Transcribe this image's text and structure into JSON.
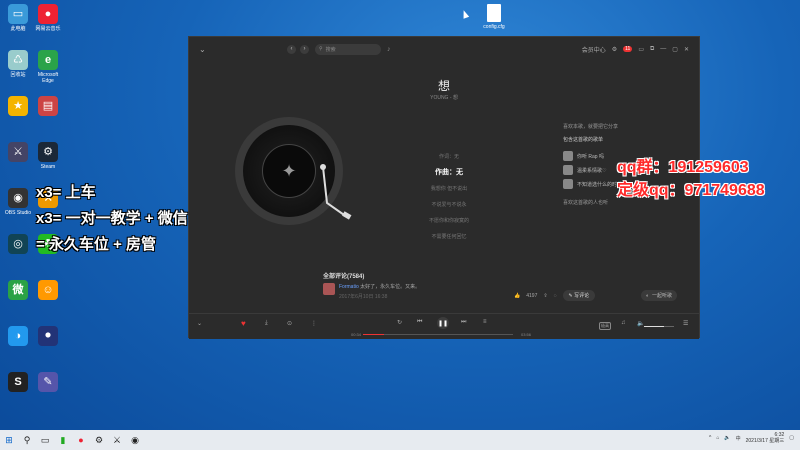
{
  "desktop": {
    "icons": [
      {
        "label": "此电脑",
        "glyph": "▭",
        "color": "#3a9ad9"
      },
      {
        "label": "网易云音乐",
        "glyph": "●",
        "color": "#e23"
      },
      {
        "label": "回收站",
        "glyph": "♺",
        "color": "#9cc"
      },
      {
        "label": "Microsoft Edge",
        "glyph": "e",
        "color": "#2aa34a"
      },
      {
        "label": "",
        "glyph": "★",
        "color": "#f4b400"
      },
      {
        "label": "",
        "glyph": "▤",
        "color": "#c44"
      },
      {
        "label": "",
        "glyph": "⚔",
        "color": "#446"
      },
      {
        "label": "Steam",
        "glyph": "⚙",
        "color": "#1b2838"
      },
      {
        "label": "OBS Studio",
        "glyph": "◉",
        "color": "#333"
      },
      {
        "label": "",
        "glyph": "⚒",
        "color": "#e90"
      },
      {
        "label": "",
        "glyph": "◎",
        "color": "#145"
      },
      {
        "label": "",
        "glyph": "☘",
        "color": "#2b2"
      },
      {
        "label": "",
        "glyph": "微",
        "color": "#2ba245"
      },
      {
        "label": "",
        "glyph": "☺",
        "color": "#f90"
      },
      {
        "label": "",
        "glyph": "◑",
        "color": "#29e"
      },
      {
        "label": "",
        "glyph": "⚫",
        "color": "#237"
      },
      {
        "label": "",
        "glyph": "S",
        "color": "#222"
      },
      {
        "label": "",
        "glyph": "✎",
        "color": "#55a"
      }
    ],
    "file": {
      "label": "config.cfg"
    }
  },
  "overlay": {
    "left_lines": [
      "x3= 上车",
      "x3= 一对一教学 + 微信",
      "= 永久车位 + 房管"
    ],
    "right_lines": [
      "qq群：191259603",
      "定级qq：971749688"
    ]
  },
  "player": {
    "titlebar": {
      "search_placeholder": "搜索",
      "vip_label": "会员中心",
      "badge": "11"
    },
    "song": {
      "title": "想",
      "artist": "YOUNG - 想"
    },
    "disc": {
      "art": "✦"
    },
    "lyrics": [
      "作词：无",
      "作曲：无",
      "我想你 但不说出",
      "不说爱与不说永",
      "不愿你和你寂寞的",
      "不需要任何回忆"
    ],
    "lyrics_active_index": 1,
    "side": {
      "head": "喜欢本歌，就要把它分享",
      "sub": "包含这首歌的歌单",
      "playlists": [
        "你听 Rap 吗",
        "温柔系情歌♡",
        "不知道选什么的时候"
      ],
      "more": "喜欢这首歌的人也听"
    },
    "comments": {
      "title": "全部评论(7584)",
      "user": "Formatio",
      "text": "太好了，永久车位。又来。",
      "date": "2017年6月10日 16:38",
      "likes": "4197",
      "write_label": "写评论",
      "listen_label": "一起听歌"
    },
    "controls": {
      "time_elapsed": "00:34",
      "time_total": "03:56",
      "progress": 0.14,
      "volume": 0.65,
      "hq_label": "极高"
    }
  },
  "taskbar": {
    "time": "6:32",
    "date": "2021/3/17 星期三"
  }
}
